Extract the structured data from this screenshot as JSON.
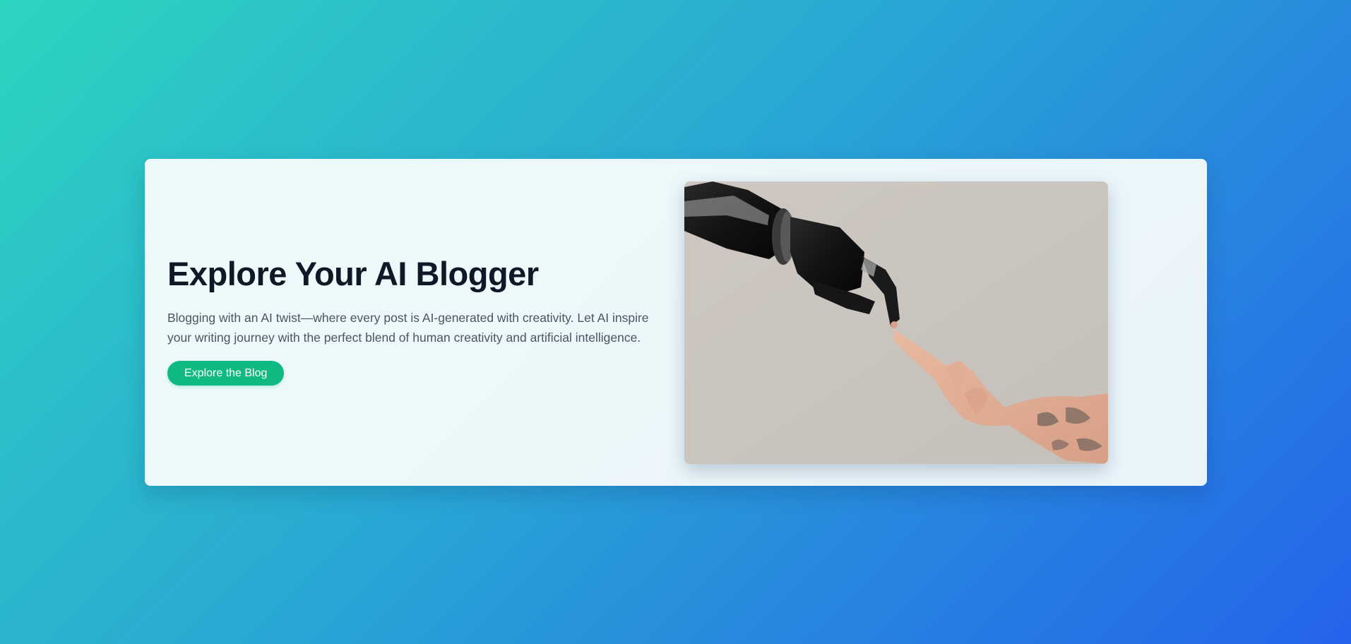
{
  "hero": {
    "title": "Explore Your AI Blogger",
    "description": "Blogging with an AI twist—where every post is AI-generated with creativity. Let AI inspire your writing journey with the perfect blend of human creativity and artificial intelligence.",
    "cta_label": "Explore the Blog",
    "image": {
      "subject": "robotic hand and human hand reaching toward each other",
      "icon": "robot-human-hands-illustration"
    }
  },
  "colors": {
    "background_start": "#2dd4bf",
    "background_end": "#2563eb",
    "card_background": "#eef8fb",
    "title": "#101828",
    "description": "#4b5563",
    "cta_background": "#10b981",
    "cta_text": "#ffffff"
  }
}
